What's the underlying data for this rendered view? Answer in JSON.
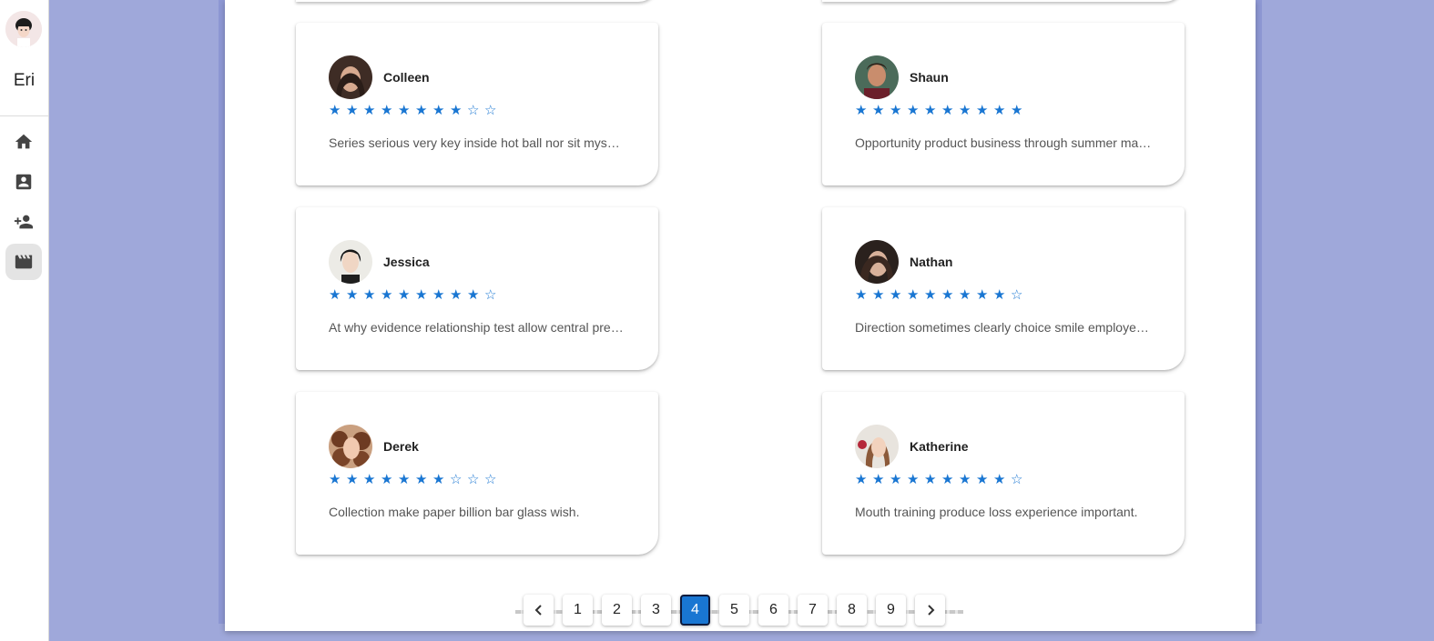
{
  "sidebar": {
    "user_name": "Eri",
    "nav": [
      {
        "icon": "home-icon"
      },
      {
        "icon": "contact-card-icon"
      },
      {
        "icon": "person-add-icon"
      },
      {
        "icon": "movie-clapper-icon",
        "active": true
      }
    ]
  },
  "reviews": [
    {
      "name": "Colleen",
      "rating": 8,
      "max": 10,
      "text": "Series serious very key inside hot ball nor sit myself dark.",
      "avatar_color": "#6d4c3d"
    },
    {
      "name": "Shaun",
      "rating": 10,
      "max": 10,
      "text": "Opportunity product business through summer many deep.",
      "avatar_color": "#8d5b45"
    },
    {
      "name": "Jessica",
      "rating": 9,
      "max": 10,
      "text": "At why evidence relationship test allow central present.",
      "avatar_color": "#2b2b2b"
    },
    {
      "name": "Nathan",
      "rating": 9,
      "max": 10,
      "text": "Direction sometimes clearly choice smile employee agent.",
      "avatar_color": "#4a3a32"
    },
    {
      "name": "Derek",
      "rating": 7,
      "max": 10,
      "text": "Collection make paper billion bar glass wish.",
      "avatar_color": "#a0603a"
    },
    {
      "name": "Katherine",
      "rating": 9,
      "max": 10,
      "text": "Mouth training produce loss experience important.",
      "avatar_color": "#b98a6a"
    }
  ],
  "pagination": {
    "prev_icon": "chevron-left-icon",
    "next_icon": "chevron-right-icon",
    "pages": [
      "1",
      "2",
      "3",
      "4",
      "5",
      "6",
      "7",
      "8",
      "9"
    ],
    "current": "4"
  },
  "colors": {
    "background": "#9fa8da",
    "accent": "#1976d2"
  }
}
